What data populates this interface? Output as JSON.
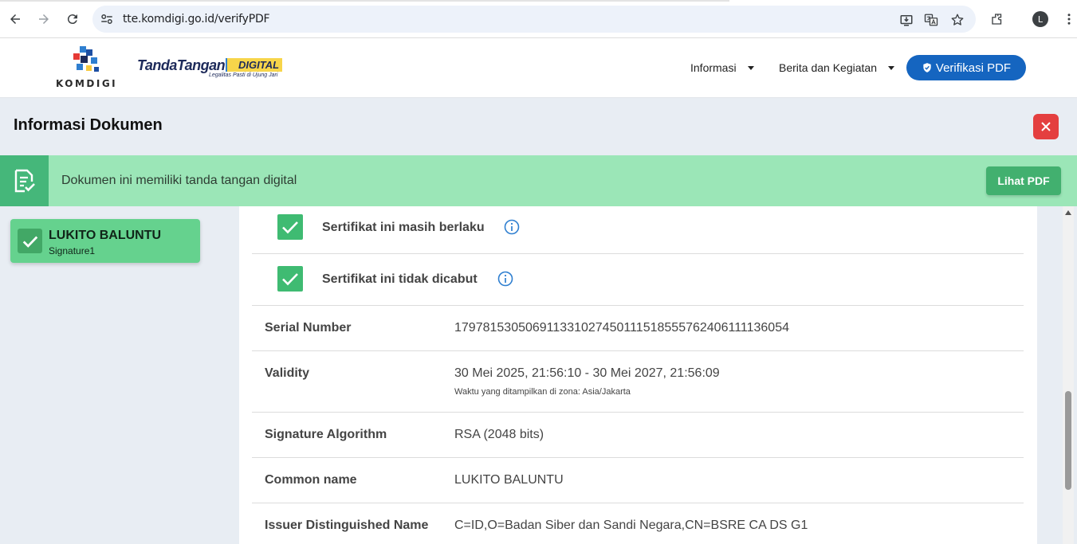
{
  "browser": {
    "url": "tte.komdigi.go.id/verifyPDF",
    "profile_initial": "L"
  },
  "header": {
    "brand_name": "KOMDIGI",
    "product_tanda": "TandaTangan",
    "product_digital": "DIGITAL",
    "product_tagline": "Legalitas Pasti di Ujung Jari",
    "menu_informasi": "Informasi",
    "menu_berita": "Berita dan Kegiatan",
    "verify_label": "Verifikasi PDF"
  },
  "page": {
    "title": "Informasi Dokumen"
  },
  "status": {
    "message": "Dokumen ini memiliki tanda tangan digital",
    "view_pdf_label": "Lihat PDF"
  },
  "signature_card": {
    "name": "LUKITO BALUNTU",
    "field": "Signature1"
  },
  "certificate": {
    "checks": [
      "Sertifikat ini masih berlaku",
      "Sertifikat ini tidak dicabut"
    ],
    "fields": [
      {
        "label": "Serial Number",
        "value": "179781530506911331027450111518555762406111136054"
      },
      {
        "label": "Validity",
        "value": "30 Mei 2025, 21:56:10 - 30 Mei 2027, 21:56:09",
        "note": "Waktu yang ditampilkan di zona: Asia/Jakarta"
      },
      {
        "label": "Signature Algorithm",
        "value": "RSA (2048 bits)"
      },
      {
        "label": "Common name",
        "value": "LUKITO BALUNTU"
      },
      {
        "label": "Issuer Distinguished Name",
        "value": "C=ID,O=Badan Siber dan Sandi Negara,CN=BSRE CA DS G1"
      }
    ]
  },
  "colors": {
    "primary": "#1565c0",
    "success_banner": "#9be6b7",
    "success_dark": "#45b77a",
    "danger": "#e43f3f",
    "check_green": "#3fbb72",
    "info_blue": "#2f7fd0"
  }
}
